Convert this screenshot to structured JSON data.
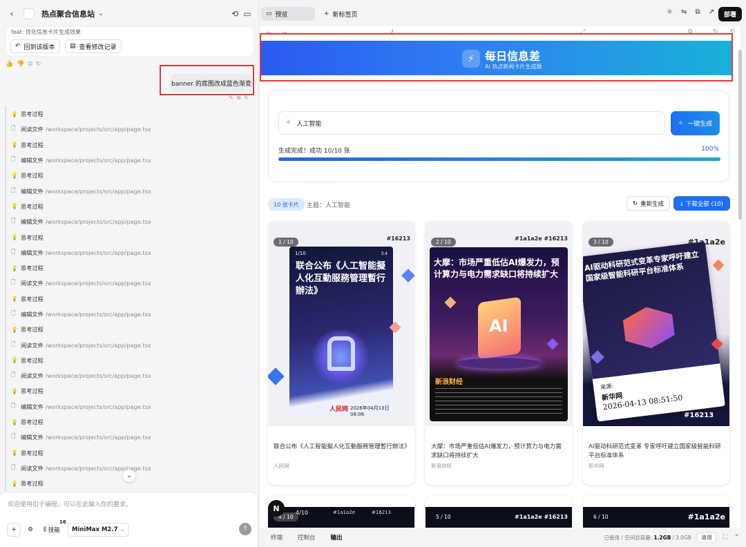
{
  "left_panel": {
    "project_title": "热点聚合信息站",
    "commit_label": "feat: 优化信息卡片生成效果",
    "revert_label": "回到该版本",
    "history_label": "查看修改记录",
    "user_message": "banner 的底图改成蓝色渐变",
    "steps": [
      {
        "icon": "bulb-icon",
        "label": "思考过程",
        "path": ""
      },
      {
        "icon": "file-icon",
        "label": "阅读文件",
        "path": "/workspace/projects/src/app/page.tsx"
      },
      {
        "icon": "bulb-icon",
        "label": "思考过程",
        "path": ""
      },
      {
        "icon": "file-icon",
        "label": "编辑文件",
        "path": "/workspace/projects/src/app/page.tsx"
      },
      {
        "icon": "bulb-icon",
        "label": "思考过程",
        "path": ""
      },
      {
        "icon": "file-icon",
        "label": "编辑文件",
        "path": "/workspace/projects/src/app/page.tsx"
      },
      {
        "icon": "bulb-icon",
        "label": "思考过程",
        "path": ""
      },
      {
        "icon": "file-icon",
        "label": "编辑文件",
        "path": "/workspace/projects/src/app/page.tsx"
      },
      {
        "icon": "bulb-icon",
        "label": "思考过程",
        "path": ""
      },
      {
        "icon": "file-icon",
        "label": "编辑文件",
        "path": "/workspace/projects/src/app/page.tsx"
      },
      {
        "icon": "bulb-icon",
        "label": "思考过程",
        "path": ""
      },
      {
        "icon": "file-icon",
        "label": "阅读文件",
        "path": "/workspace/projects/src/app/page.tsx"
      },
      {
        "icon": "bulb-icon",
        "label": "思考过程",
        "path": ""
      },
      {
        "icon": "file-icon",
        "label": "编辑文件",
        "path": "/workspace/projects/src/app/page.tsx"
      },
      {
        "icon": "bulb-icon",
        "label": "思考过程",
        "path": ""
      },
      {
        "icon": "file-icon",
        "label": "阅读文件",
        "path": "/workspace/projects/src/app/page.tsx"
      },
      {
        "icon": "bulb-icon",
        "label": "思考过程",
        "path": ""
      },
      {
        "icon": "file-icon",
        "label": "阅读文件",
        "path": "/workspace/projects/src/app/page.tsx"
      },
      {
        "icon": "bulb-icon",
        "label": "思考过程",
        "path": ""
      },
      {
        "icon": "file-icon",
        "label": "编辑文件",
        "path": "/workspace/projects/src/app/page.tsx"
      },
      {
        "icon": "bulb-icon",
        "label": "思考过程",
        "path": ""
      },
      {
        "icon": "file-icon",
        "label": "编辑文件",
        "path": "/workspace/projects/src/app/page.tsx"
      },
      {
        "icon": "bulb-icon",
        "label": "思考过程",
        "path": ""
      },
      {
        "icon": "file-icon",
        "label": "阅读文件",
        "path": "/workspace/projects/src/app/page.tsx"
      },
      {
        "icon": "bulb-icon",
        "label": "思考过程",
        "path": ""
      }
    ],
    "composer_placeholder": "欢迎使用扣子编程，可以在此输入你的要求。",
    "skills_label": "技能",
    "skills_count": "16",
    "model_label": "MiniMax M2.7"
  },
  "topbar": {
    "tab_preview": "预览",
    "tab_new": "新标签页",
    "deploy": "部署"
  },
  "browser": {
    "url": "/"
  },
  "banner": {
    "title": "每日信息差",
    "subtitle": "AI 热点新闻卡片生成器"
  },
  "generator": {
    "topic_value": "人工智能",
    "button": "一键生成",
    "status": "生成完成！成功 10/10 张",
    "percent": "100%",
    "progress": 1.0
  },
  "toolbar": {
    "count": "10 张卡片",
    "theme": "主题：人工智能",
    "regen": "重新生成",
    "download": "下载全部 (10)"
  },
  "cards": [
    {
      "badge": "1 / 10",
      "hash": "#16213",
      "title": "联合公布《人工智能擬人化互動服務管理暫行辦法》",
      "source": "人民网",
      "poster": {
        "index": "1/10",
        "page": "3.4",
        "headline": "联合公布《人工智能擬人化互動服務管理暫行辦法》",
        "brand": "人民网",
        "date": "2026年04月13日08:06"
      }
    },
    {
      "badge": "2 / 10",
      "hash": "#1a1a2e #16213",
      "title": "大摩：市场严重低估AI爆发力，预计算力与电力需求缺口将持续扩大",
      "source": "新浪财经",
      "poster": {
        "headline": "大摩：市场严重低估AI爆发力，预计算力与电力需求缺口将持续扩大",
        "brand": "新浪财经",
        "mid": "AI"
      }
    },
    {
      "badge": "3 / 10",
      "hash": "#1a1a2e",
      "title": "AI驱动科研范式变革 专家呼吁建立国家级智能科研平台标准体系",
      "source": "新华网",
      "poster": {
        "headline": "AI驱动科研范式变革专家呼吁建立国家级智能科研平台标准体系",
        "brand": "新华网",
        "date": "2026-04-13 08:51:50",
        "source_label": "来源:",
        "tag": "#16213"
      }
    }
  ],
  "row2": [
    {
      "badge": "4 / 10",
      "tag": "4/10",
      "hash": "#1a1a2e",
      "hash2": "#16213"
    },
    {
      "badge": "5 / 10",
      "hash": "#1a1a2e #16213"
    },
    {
      "badge": "6 / 10",
      "hash": "#1a1a2e"
    }
  ],
  "bottombar": {
    "tabs": [
      "终端",
      "控制台",
      "输出"
    ],
    "usage_prefix": "已使用 / 空间总容量:",
    "used": "1.2GB",
    "total": "3.0GB",
    "clear": "清理"
  },
  "colors": {
    "accent": "#1d6ff2",
    "banner_start": "#2a5bf0",
    "banner_end": "#18b2d8",
    "highlight": "#e53935"
  }
}
